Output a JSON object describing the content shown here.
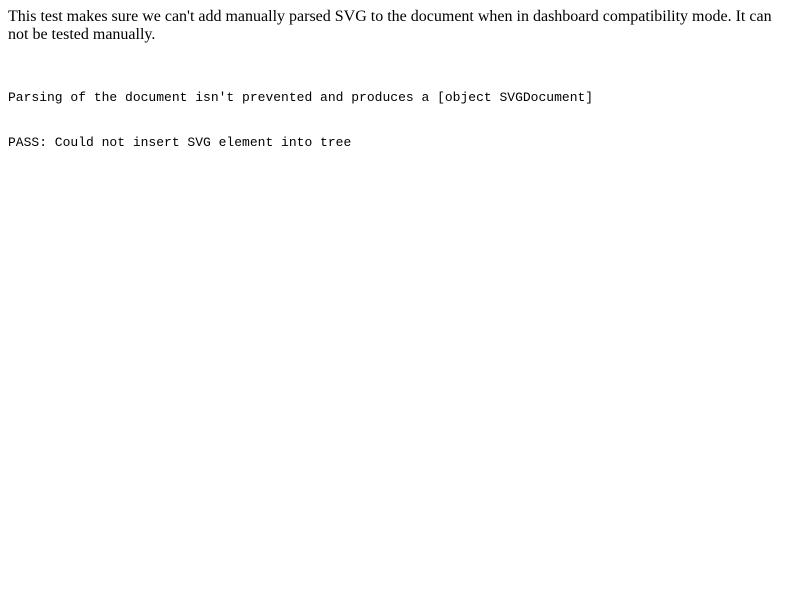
{
  "page": {
    "description": "This test makes sure we can't add manually parsed SVG to the document when in dashboard compatibility mode. It can not be tested manually.",
    "output_lines": [
      "Parsing of the document isn't prevented and produces a [object SVGDocument]",
      "PASS: Could not insert SVG element into tree"
    ]
  }
}
